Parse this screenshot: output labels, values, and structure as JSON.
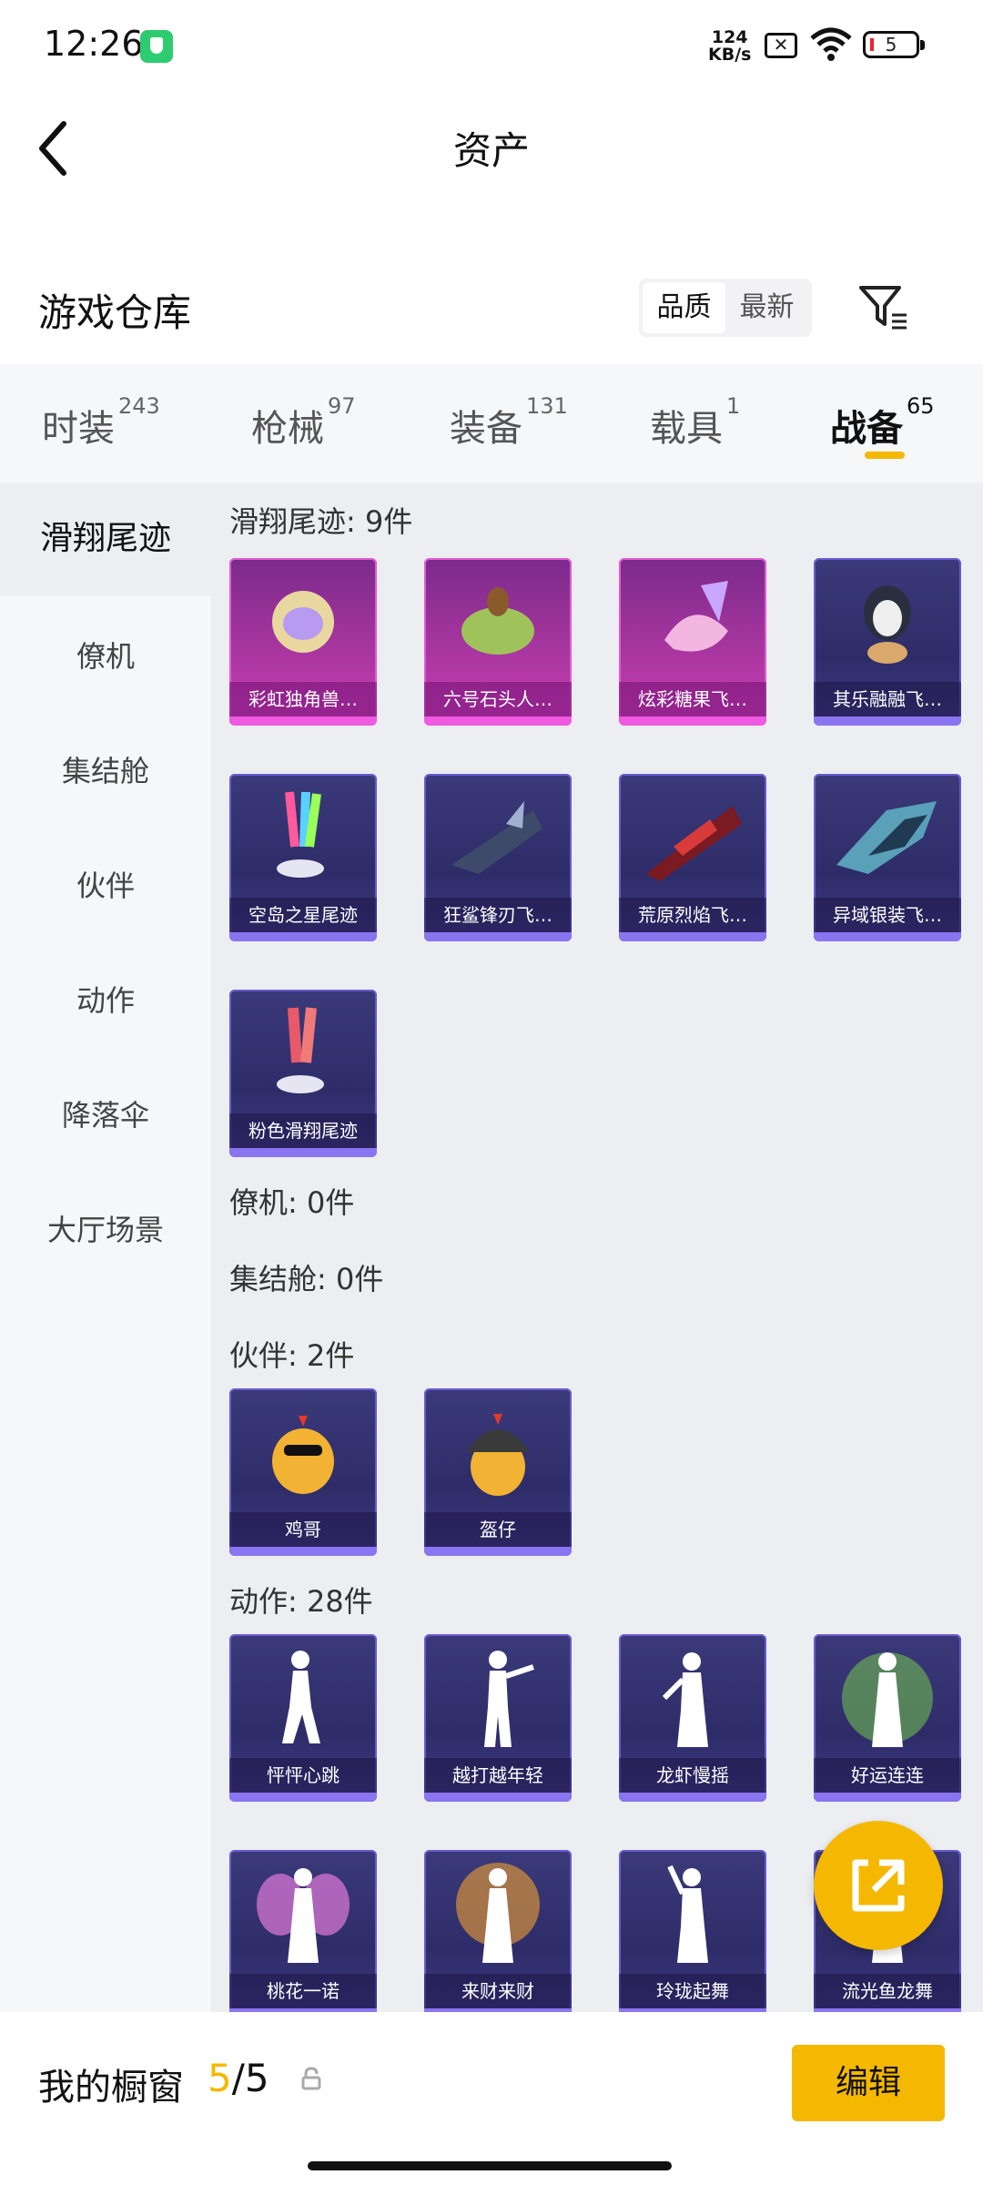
{
  "status_bar": {
    "time": "12:26",
    "net_speed_top": "124",
    "net_speed_bottom": "KB/s",
    "battery": "5",
    "sim_label": "✕"
  },
  "header": {
    "title": "资产"
  },
  "warehouse": {
    "title": "游戏仓库",
    "sort_options": [
      "品质",
      "最新"
    ],
    "sort_selected": "品质"
  },
  "tabs": [
    {
      "label": "时装",
      "count": "243"
    },
    {
      "label": "枪械",
      "count": "97"
    },
    {
      "label": "装备",
      "count": "131"
    },
    {
      "label": "载具",
      "count": "1"
    },
    {
      "label": "战备",
      "count": "65",
      "active": true
    }
  ],
  "sidebar": [
    "滑翔尾迹",
    "僚机",
    "集结舱",
    "伙伴",
    "动作",
    "降落伞",
    "大厅场景"
  ],
  "sections": {
    "trail": {
      "title": "滑翔尾迹: 9件",
      "items": [
        "彩虹独角兽…",
        "六号石头人…",
        "炫彩糖果飞…",
        "其乐融融飞…",
        "空岛之星尾迹",
        "狂鲨锋刃飞…",
        "荒原烈焰飞…",
        "异域银装飞…",
        "粉色滑翔尾迹"
      ]
    },
    "wingman": {
      "title": "僚机: 0件"
    },
    "pod": {
      "title": "集结舱: 0件"
    },
    "partner": {
      "title": "伙伴: 2件",
      "items": [
        "鸡哥",
        "盔仔"
      ]
    },
    "emote": {
      "title": "动作: 28件",
      "items": [
        "怦怦心跳",
        "越打越年轻",
        "龙虾慢摇",
        "好运连连",
        "桃花一诺",
        "来财来财",
        "玲珑起舞",
        "流光鱼龙舞"
      ]
    }
  },
  "bottom": {
    "label": "我的橱窗",
    "count_current": "5",
    "count_sep": "/",
    "count_total": "5",
    "edit": "编辑"
  },
  "colors": {
    "accent": "#f5b800",
    "card_purple": "#2e2c68",
    "card_pink": "#a8369f"
  }
}
